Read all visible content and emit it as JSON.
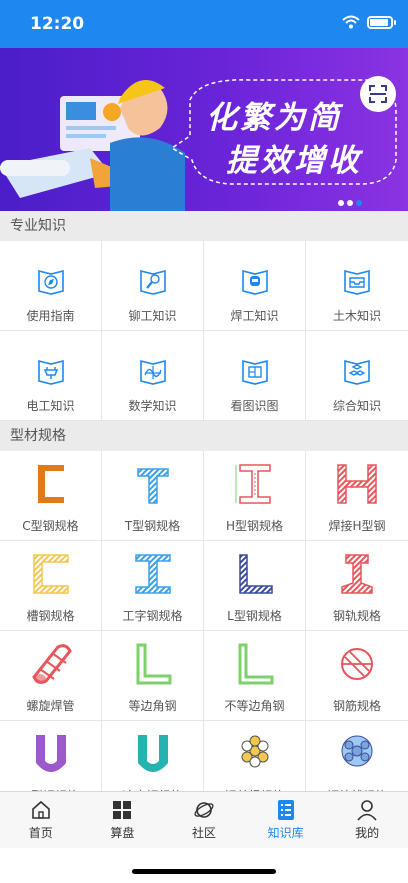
{
  "status_bar": {
    "time": "12:20"
  },
  "banner": {
    "line1": "化繁为简",
    "line2": "提效增收",
    "page_count": 3,
    "active_page": 3
  },
  "sections": {
    "knowledge": {
      "title": "专业知识",
      "items": [
        {
          "label": "使用指南",
          "icon": "compass-book-icon"
        },
        {
          "label": "铆工知识",
          "icon": "wrench-book-icon"
        },
        {
          "label": "焊工知识",
          "icon": "welder-book-icon"
        },
        {
          "label": "土木知识",
          "icon": "inbox-book-icon"
        },
        {
          "label": "电工知识",
          "icon": "plug-book-icon"
        },
        {
          "label": "数学知识",
          "icon": "function-book-icon"
        },
        {
          "label": "看图识图",
          "icon": "blueprint-book-icon"
        },
        {
          "label": "综合知识",
          "icon": "cubes-book-icon"
        }
      ]
    },
    "profiles": {
      "title": "型材规格",
      "items": [
        {
          "label": "C型钢规格",
          "icon": "c-steel-icon"
        },
        {
          "label": "T型钢规格",
          "icon": "t-steel-icon"
        },
        {
          "label": "H型钢规格",
          "icon": "h-steel-icon"
        },
        {
          "label": "焊接H型钢",
          "icon": "welded-h-steel-icon"
        },
        {
          "label": "槽钢规格",
          "icon": "channel-steel-icon"
        },
        {
          "label": "工字钢规格",
          "icon": "i-beam-icon"
        },
        {
          "label": "L型钢规格",
          "icon": "l-steel-icon"
        },
        {
          "label": "钢轨规格",
          "icon": "rail-icon"
        },
        {
          "label": "螺旋焊管",
          "icon": "spiral-pipe-icon"
        },
        {
          "label": "等边角钢",
          "icon": "equal-angle-icon"
        },
        {
          "label": "不等边角钢",
          "icon": "unequal-angle-icon"
        },
        {
          "label": "钢筋规格",
          "icon": "rebar-icon"
        },
        {
          "label": "U型钢规格",
          "icon": "u-steel-icon"
        },
        {
          "label": "冷弯钢规格",
          "icon": "cold-bent-steel-icon"
        },
        {
          "label": "钢丝绳规格",
          "icon": "wire-rope-icon"
        },
        {
          "label": "钢绞线规格",
          "icon": "strand-icon"
        }
      ]
    }
  },
  "tabbar": {
    "items": [
      {
        "label": "首页",
        "icon": "home-icon"
      },
      {
        "label": "算盘",
        "icon": "grid-icon"
      },
      {
        "label": "社区",
        "icon": "planet-icon"
      },
      {
        "label": "知识库",
        "icon": "book-icon",
        "active": true
      },
      {
        "label": "我的",
        "icon": "person-icon"
      }
    ]
  },
  "colors": {
    "primary": "#1e88f0",
    "orange": "#e07a1a",
    "red": "#e8555b",
    "yellow": "#f2c94c",
    "green": "#7ed06b",
    "purple": "#9b59c9",
    "teal": "#26b3b0",
    "navy": "#3a4ca0"
  }
}
